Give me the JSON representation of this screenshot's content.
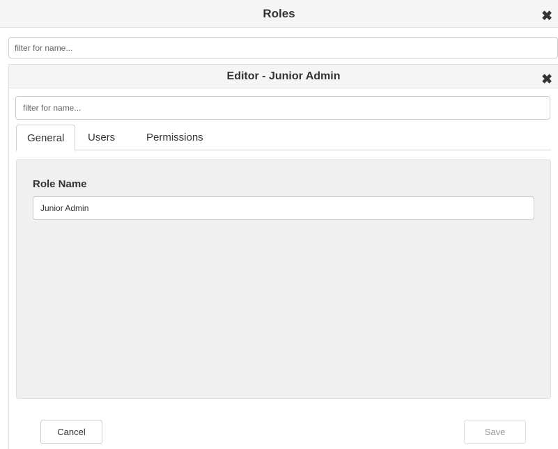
{
  "roles_window": {
    "title": "Roles",
    "close_glyph": "✖",
    "filter_placeholder": "filter for name..."
  },
  "editor": {
    "title": "Editor - Junior Admin",
    "close_glyph": "✖",
    "filter_placeholder": "filter for name...",
    "tabs": [
      {
        "label": "General",
        "active": true
      },
      {
        "label": "Users",
        "active": false
      },
      {
        "label": "Permissions",
        "active": false
      }
    ],
    "general": {
      "role_name_label": "Role Name",
      "role_name_value": "Junior Admin"
    },
    "buttons": {
      "cancel_label": "Cancel",
      "save_label": "Save",
      "save_enabled": false
    }
  }
}
